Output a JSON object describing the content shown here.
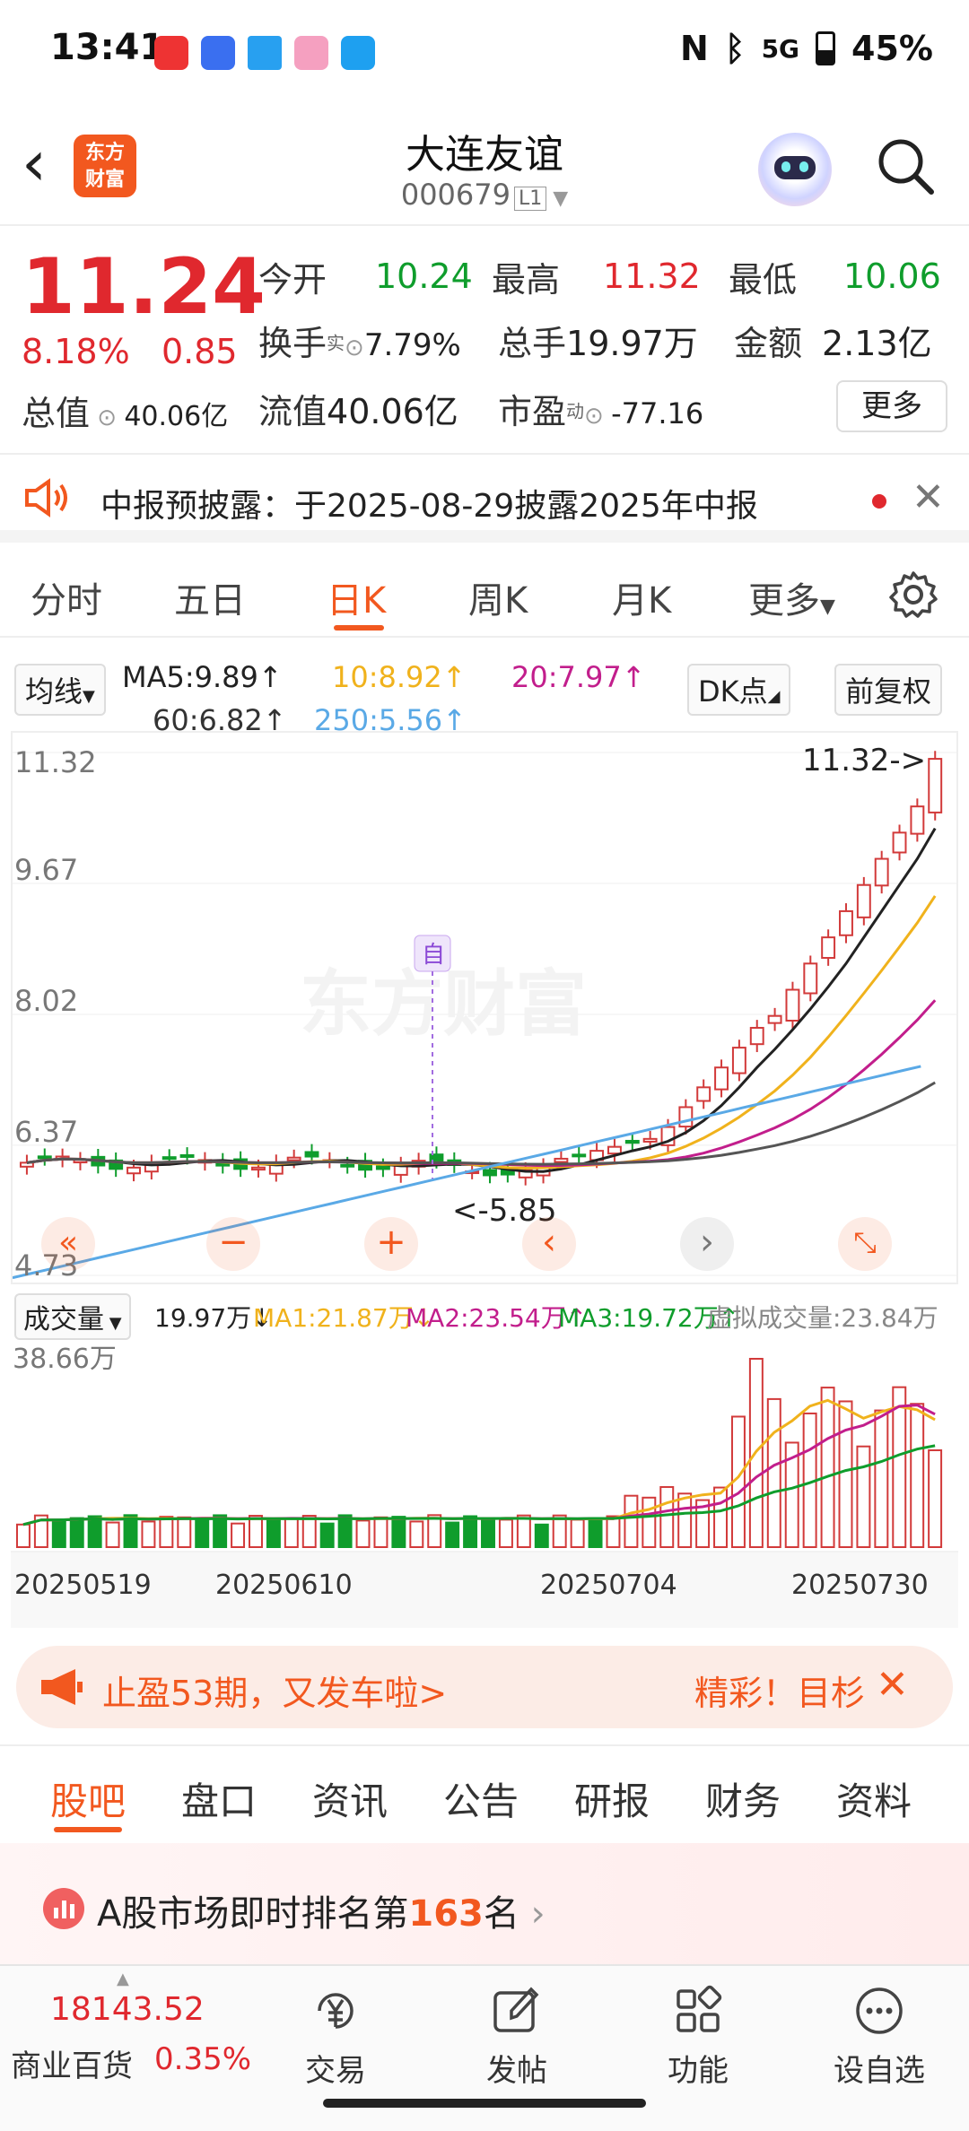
{
  "status": {
    "time": "13:41",
    "battery": "45%",
    "net": "5G"
  },
  "header": {
    "logo_line1": "东方",
    "logo_line2": "财富",
    "title": "大连友谊",
    "code": "000679",
    "level": "L1"
  },
  "quote": {
    "price": "11.24",
    "change_pct": "8.18%",
    "change": "0.85",
    "open_label": "今开",
    "open": "10.24",
    "high_label": "最高",
    "high": "11.32",
    "low_label": "最低",
    "low": "10.06",
    "turnover_label": "换手",
    "turnover_sup": "实",
    "turnover": "7.79%",
    "volume_label": "总手",
    "volume": "19.97万",
    "amount_label": "金额",
    "amount": "2.13亿",
    "mktcap_label": "总值",
    "mktcap": "40.06亿",
    "float_label": "流值",
    "float": "40.06亿",
    "pe_label": "市盈",
    "pe_sup": "动",
    "pe": "-77.16",
    "more": "更多"
  },
  "notice": {
    "text": "中报预披露：于2025-08-29披露2025年中报"
  },
  "tabs": [
    "分时",
    "五日",
    "日K",
    "周K",
    "月K",
    "更多"
  ],
  "active_tab": "日K",
  "ma": {
    "toggle": "均线",
    "ma5": "MA5:9.89↑",
    "ma10": "10:8.92↑",
    "ma20": "20:7.97↑",
    "ma60": "60:6.82↑",
    "ma250": "250:5.56↑",
    "dk": "DK点",
    "fq": "前复权",
    "colors": {
      "ma5": "#222222",
      "ma10": "#f0b21c",
      "ma20": "#c21e8c",
      "ma60": "#555555",
      "ma250": "#5aa9e6"
    }
  },
  "kline_axis": [
    "11.32",
    "9.67",
    "8.02",
    "6.37",
    "4.73"
  ],
  "kline_labels": {
    "high_mark": "11.32->",
    "low_mark": "<-5.85",
    "self_mark": "自",
    "watermark": "东方财富"
  },
  "vol_row": {
    "toggle": "成交量",
    "vol": "19.97万↓",
    "ma1": "MA1:21.87万↓",
    "ma2": "MA2:23.54万↑",
    "ma3": "MA3:19.72万↑",
    "virtual": "虚拟成交量:23.84万"
  },
  "vol_axis_max": "38.66万",
  "dates": [
    "20250519",
    "20250610",
    "20250704",
    "20250730"
  ],
  "ad": {
    "left": "止盈53期，又发车啦>",
    "right": "精彩！目杉"
  },
  "bottom_tabs": [
    "股吧",
    "盘口",
    "资讯",
    "公告",
    "研报",
    "财务",
    "资料"
  ],
  "rank": {
    "prefix": "A股市场即时排名第",
    "num": "163",
    "suffix": "名"
  },
  "bottom": {
    "index_value": "18143.52",
    "index_name": "商业百货",
    "index_pct": "0.35%",
    "items": [
      "交易",
      "发帖",
      "功能",
      "设自选"
    ]
  }
}
